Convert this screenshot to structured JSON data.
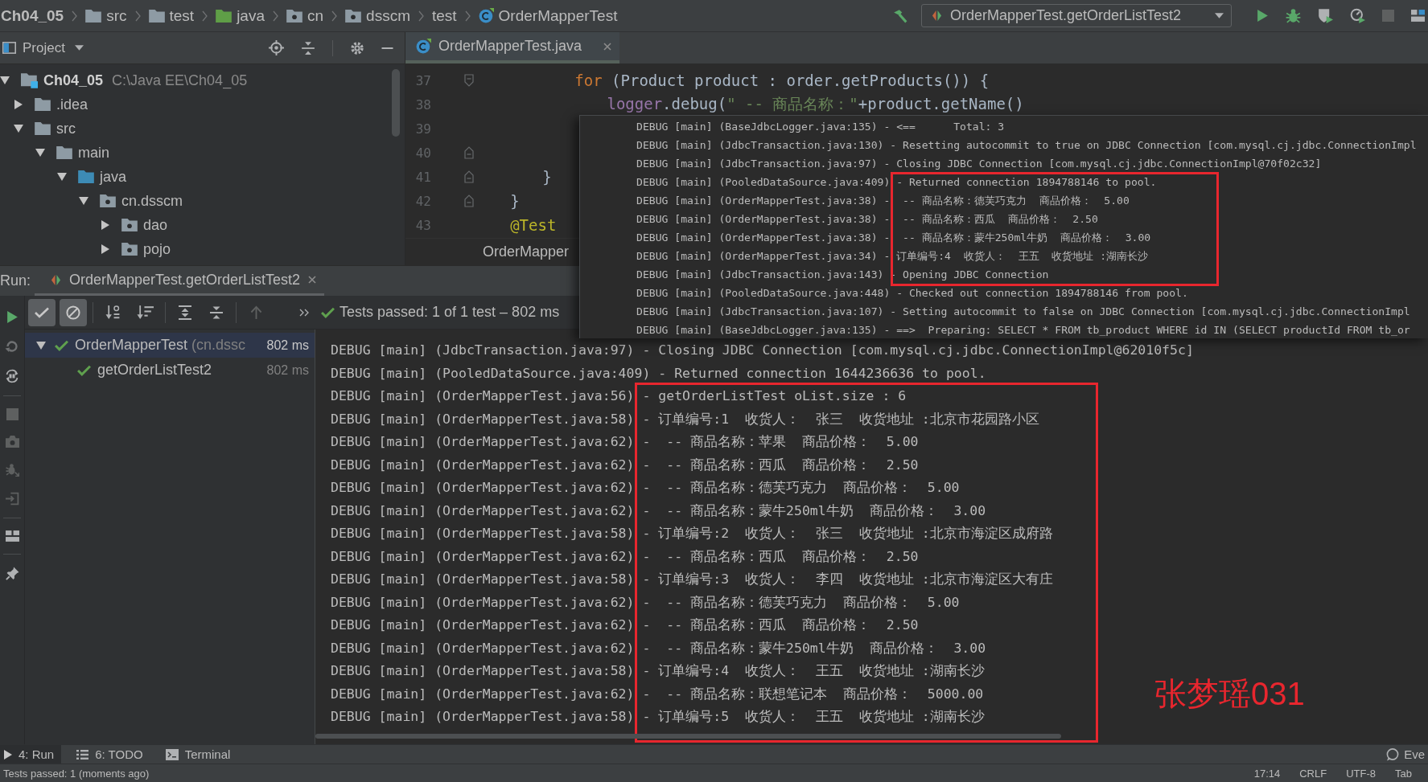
{
  "navigation_bar": {
    "breadcrumbs": [
      {
        "label": "Ch04_05",
        "kind": "project"
      },
      {
        "label": "src",
        "kind": "folder"
      },
      {
        "label": "test",
        "kind": "folder"
      },
      {
        "label": "java",
        "kind": "test-root"
      },
      {
        "label": "cn",
        "kind": "package"
      },
      {
        "label": "dsscm",
        "kind": "package"
      },
      {
        "label": "test",
        "kind": "plain"
      },
      {
        "label": "OrderMapperTest",
        "kind": "class"
      }
    ],
    "run_configuration": "OrderMapperTest.getOrderListTest2"
  },
  "project_panel": {
    "title": "Project",
    "tree": [
      {
        "label": "Ch04_05",
        "location": "C:\\Java EE\\Ch04_05",
        "kind": "module",
        "expanded": true,
        "children": [
          {
            "label": ".idea",
            "kind": "folder",
            "expanded": false
          },
          {
            "label": "src",
            "kind": "folder",
            "expanded": true,
            "children": [
              {
                "label": "main",
                "kind": "folder",
                "expanded": true,
                "children": [
                  {
                    "label": "java",
                    "kind": "source-root",
                    "expanded": true,
                    "children": [
                      {
                        "label": "cn.dsscm",
                        "kind": "package",
                        "expanded": true,
                        "children": [
                          {
                            "label": "dao",
                            "kind": "package",
                            "expanded": false
                          },
                          {
                            "label": "pojo",
                            "kind": "package",
                            "expanded": false
                          }
                        ]
                      }
                    ]
                  }
                ]
              }
            ]
          }
        ]
      }
    ]
  },
  "editor": {
    "tabs": [
      {
        "label": "OrderMapperTest.java",
        "selected": true
      }
    ],
    "lines": [
      {
        "number": "37",
        "fold_start": true,
        "code": [
          {
            "kind": "keyword",
            "text": "            for"
          },
          {
            "kind": "plain",
            "text": " (Product product : order.getProducts()) {"
          }
        ]
      },
      {
        "number": "38",
        "code": [
          {
            "kind": "field",
            "text": "                logger"
          },
          {
            "kind": "plain",
            "text": ".debug("
          },
          {
            "kind": "string",
            "text": "\" -- 商品名称：\""
          },
          {
            "kind": "plain",
            "text": "+product.getName()"
          }
        ]
      },
      {
        "number": "39"
      },
      {
        "number": "40",
        "fold_end": true
      },
      {
        "number": "41",
        "fold_end": true,
        "code": [
          {
            "kind": "plain",
            "text": "        }"
          }
        ]
      },
      {
        "number": "42",
        "fold_end": true,
        "code": [
          {
            "kind": "plain",
            "text": "    }"
          }
        ]
      },
      {
        "number": "43",
        "code": [
          {
            "kind": "annotation",
            "text": "    @Test"
          }
        ]
      }
    ],
    "breadcrumb": "OrderMapper"
  },
  "log_popup": {
    "blocks": [
      {
        "highlighted": false,
        "lines": [
          "DEBUG [main] (BaseJdbcLogger.java:135) - <==      Total: 3",
          "DEBUG [main] (JdbcTransaction.java:130) - Resetting autocommit to true on JDBC Connection [com.mysql.cj.jdbc.ConnectionImpl",
          "DEBUG [main] (JdbcTransaction.java:97) - Closing JDBC Connection [com.mysql.cj.jdbc.ConnectionImpl@70f02c32]"
        ]
      },
      {
        "highlighted": true,
        "lines": [
          "DEBUG [main] (PooledDataSource.java:409) - Returned connection 1894788146 to pool.",
          "DEBUG [main] (OrderMapperTest.java:38) -  -- 商品名称：德芙巧克力  商品价格：  5.00",
          "DEBUG [main] (OrderMapperTest.java:38) -  -- 商品名称：西瓜  商品价格：  2.50",
          "DEBUG [main] (OrderMapperTest.java:38) -  -- 商品名称：蒙牛250ml牛奶  商品价格：  3.00",
          "DEBUG [main] (OrderMapperTest.java:34) - 订单编号:4  收货人：  王五  收货地址 :湖南长沙",
          "DEBUG [main] (JdbcTransaction.java:143) - Opening JDBC Connection"
        ]
      },
      {
        "highlighted": false,
        "lines": [
          "DEBUG [main] (PooledDataSource.java:448) - Checked out connection 1894788146 from pool.",
          "DEBUG [main] (JdbcTransaction.java:107) - Setting autocommit to false on JDBC Connection [com.mysql.cj.jdbc.ConnectionImpl",
          "DEBUG [main] (BaseJdbcLogger.java:135) - ==>  Preparing: SELECT * FROM tb_product WHERE id IN (SELECT productId FROM tb_or"
        ]
      }
    ]
  },
  "run_panel": {
    "title": "Run:",
    "tabs": [
      {
        "label": "OrderMapperTest.getOrderListTest2",
        "selected": true
      }
    ],
    "filters": [
      {
        "kind": "passed",
        "selected": true
      },
      {
        "kind": "ignored",
        "selected": true
      }
    ],
    "summary": "Tests passed: 1 of 1 test – 802 ms",
    "tests": [
      {
        "name": "OrderMapperTest",
        "package": "(cn.dssc",
        "duration": "802 ms",
        "passed": true,
        "selected": true,
        "expanded": true,
        "children": [
          {
            "name": "getOrderListTest2",
            "duration": "802 ms",
            "passed": true,
            "selected": false
          }
        ]
      }
    ],
    "console": {
      "blocks": [
        {
          "highlighted": false,
          "lines": [
            "DEBUG [main] (JdbcTransaction.java:97) - Closing JDBC Connection [com.mysql.cj.jdbc.ConnectionImpl@62010f5c]",
            "DEBUG [main] (PooledDataSource.java:409) - Returned connection 1644236636 to pool."
          ]
        },
        {
          "highlighted": true,
          "lines": [
            "DEBUG [main] (OrderMapperTest.java:56) - getOrderListTest oList.size : 6",
            "DEBUG [main] (OrderMapperTest.java:58) - 订单编号:1  收货人：  张三  收货地址 :北京市花园路小区",
            "DEBUG [main] (OrderMapperTest.java:62) -  -- 商品名称：苹果  商品价格：  5.00",
            "DEBUG [main] (OrderMapperTest.java:62) -  -- 商品名称：西瓜  商品价格：  2.50",
            "DEBUG [main] (OrderMapperTest.java:62) -  -- 商品名称：德芙巧克力  商品价格：  5.00",
            "DEBUG [main] (OrderMapperTest.java:62) -  -- 商品名称：蒙牛250ml牛奶  商品价格：  3.00",
            "DEBUG [main] (OrderMapperTest.java:58) - 订单编号:2  收货人：  张三  收货地址 :北京市海淀区成府路",
            "DEBUG [main] (OrderMapperTest.java:62) -  -- 商品名称：西瓜  商品价格：  2.50",
            "DEBUG [main] (OrderMapperTest.java:58) - 订单编号:3  收货人：  李四  收货地址 :北京市海淀区大有庄",
            "DEBUG [main] (OrderMapperTest.java:62) -  -- 商品名称：德芙巧克力  商品价格：  5.00",
            "DEBUG [main] (OrderMapperTest.java:62) -  -- 商品名称：西瓜  商品价格：  2.50",
            "DEBUG [main] (OrderMapperTest.java:62) -  -- 商品名称：蒙牛250ml牛奶  商品价格：  3.00",
            "DEBUG [main] (OrderMapperTest.java:58) - 订单编号:4  收货人：  王五  收货地址 :湖南长沙",
            "DEBUG [main] (OrderMapperTest.java:62) -  -- 商品名称：联想笔记本  商品价格：  5000.00",
            "DEBUG [main] (OrderMapperTest.java:58) - 订单编号:5  收货人：  王五  收货地址 :湖南长沙"
          ]
        }
      ]
    },
    "annotation_note": "张梦瑶031"
  },
  "tool_window_bar": {
    "buttons": [
      {
        "label": "4: Run",
        "kind": "run",
        "selected": true
      },
      {
        "label": "6: TODO",
        "kind": "todo",
        "selected": false
      },
      {
        "label": "Terminal",
        "kind": "terminal",
        "selected": false
      }
    ],
    "event_log": "Eve"
  },
  "status_bar": {
    "message": "Tests passed: 1 (moments ago)",
    "items": [
      "17:14",
      "CRLF",
      "UTF-8",
      "Tab"
    ]
  }
}
